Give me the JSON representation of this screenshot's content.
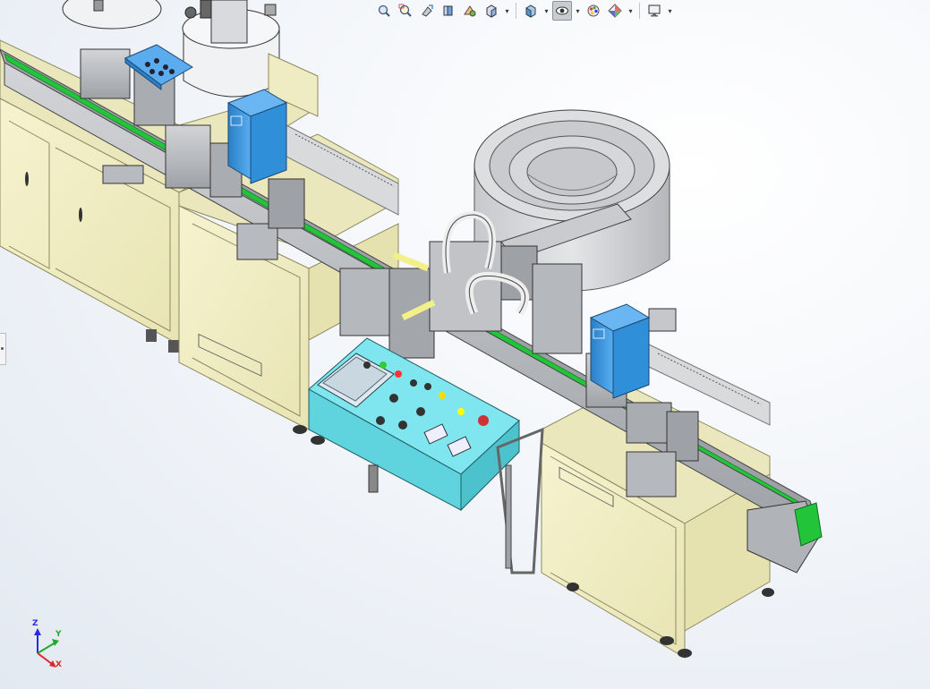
{
  "window": {
    "title": ""
  },
  "toolbar": {
    "items": [
      {
        "name": "zoom-to-fit",
        "icon": "zoom-to-fit-icon",
        "has_dropdown": false
      },
      {
        "name": "zoom-to-area",
        "icon": "zoom-to-area-icon",
        "has_dropdown": false
      },
      {
        "name": "previous-view",
        "icon": "previous-view-icon",
        "has_dropdown": false
      },
      {
        "name": "section-view",
        "icon": "section-view-icon",
        "has_dropdown": false
      },
      {
        "name": "dynamic-annotation",
        "icon": "dynamic-annotation-icon",
        "has_dropdown": false
      },
      {
        "name": "view-orientation",
        "icon": "view-orientation-icon",
        "has_dropdown": true
      },
      {
        "name": "display-style",
        "icon": "display-style-icon",
        "has_dropdown": true
      },
      {
        "name": "hide-show-items",
        "icon": "eye-icon",
        "has_dropdown": true,
        "active": true
      },
      {
        "name": "edit-appearance",
        "icon": "edit-appearance-icon",
        "has_dropdown": false
      },
      {
        "name": "apply-scene",
        "icon": "scene-icon",
        "has_dropdown": true
      },
      {
        "name": "view-settings",
        "icon": "monitor-icon",
        "has_dropdown": true
      }
    ]
  },
  "triad": {
    "x_label": "X",
    "y_label": "Y",
    "z_label": "Z"
  },
  "colors": {
    "cabinet": "#f2efc6",
    "cabinet_edge": "#8e8a62",
    "conveyor_belt": "#22c43a",
    "frame_grey": "#b9bcc0",
    "head_blue": "#2f8fd8",
    "control_panel": "#7fe6ef",
    "bowl_grey": "#d4d6d9",
    "background": "#eef2f7"
  }
}
